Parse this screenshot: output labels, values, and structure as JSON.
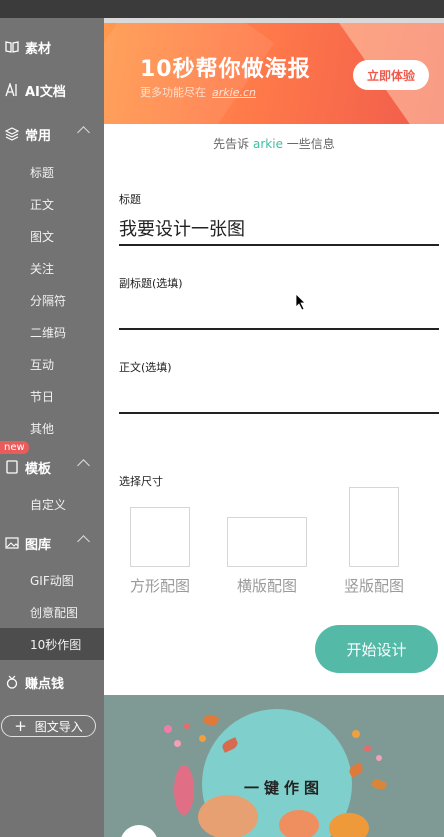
{
  "sidebar": {
    "materials": "素材",
    "ai_docs": "AI文档",
    "common": "常用",
    "common_items": [
      "标题",
      "正文",
      "图文",
      "关注",
      "分隔符",
      "二维码",
      "互动",
      "节日",
      "其他"
    ],
    "new_badge": "new",
    "templates": "模板",
    "template_items": [
      "自定义"
    ],
    "gallery": "图库",
    "gallery_items": [
      "GIF动图",
      "创意配图",
      "10秒作图"
    ],
    "earn": "赚点钱",
    "import_button": "图文导入"
  },
  "banner": {
    "title": "10秒帮你做海报",
    "subtitle": "更多功能尽在",
    "link": "arkie.cn",
    "button": "立即体验"
  },
  "form": {
    "intro_prefix": "先告诉",
    "intro_brand": "arkie",
    "intro_suffix": "一些信息",
    "title_label": "标题",
    "title_value": "我要设计一张图",
    "subtitle_label": "副标题(选填)",
    "subtitle_value": "",
    "body_label": "正文(选填)",
    "body_value": "",
    "size_label": "选择尺寸",
    "sizes": [
      "方形配图",
      "横版配图",
      "竖版配图"
    ],
    "start_button": "开始设计"
  },
  "illustration": {
    "title": "一键作图"
  },
  "colors": {
    "sidebar_bg": "#737373",
    "active_item": "#4d4d4d",
    "accent": "#55b9a8",
    "brand_text": "#3dbfa3",
    "banner_orange": "#f05a4c"
  },
  "icons": [
    "book-icon",
    "ai-icon",
    "layers-icon",
    "template-icon",
    "image-icon",
    "medal-icon",
    "plus-icon"
  ]
}
